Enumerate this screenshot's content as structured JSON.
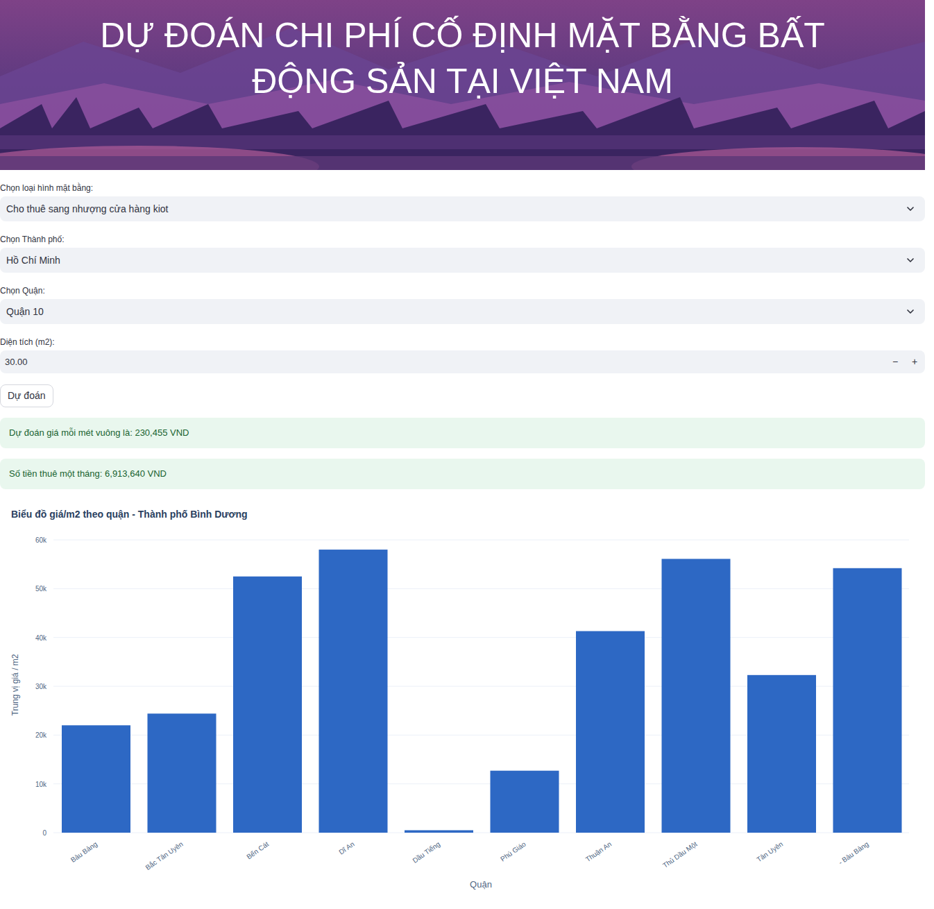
{
  "banner": {
    "title_lines": [
      "DỰ ĐOÁN CHI PHÍ CỐ ĐỊNH MẶT BẰNG BẤT",
      "ĐỘNG SẢN TẠI VIỆT NAM"
    ]
  },
  "form": {
    "fields": [
      {
        "label": "Chọn loại hình mặt bằng:",
        "value": "Cho thuê sang nhượng cửa hàng kiot",
        "kind": "select"
      },
      {
        "label": "Chọn Thành phố:",
        "value": "Hồ Chí Minh",
        "kind": "select"
      },
      {
        "label": "Chọn Quận:",
        "value": "Quận 10",
        "kind": "select"
      },
      {
        "label": "Diện tích (m2):",
        "value": "30.00",
        "kind": "number",
        "decrement": "−",
        "increment": "+"
      }
    ]
  },
  "button": "Dự đoán",
  "results": [
    "Dự đoán giá mỗi mét vuông là: 230,455 VND",
    "Số tiền thuê một tháng: 6,913,640 VND"
  ],
  "chart": {
    "title": "Biểu đồ giá/m2 theo quận - Thành phố Bình Dương",
    "y_axis_title": "Trung vị giá / m2",
    "x_axis_title": "Quận",
    "y_ticks": [
      "0",
      "10k",
      "20k",
      "30k",
      "40k",
      "50k",
      "60k"
    ],
    "y_tick_values": [
      0,
      10000,
      20000,
      30000,
      40000,
      50000,
      60000
    ],
    "categories": [
      "Bàu Bàng",
      "Bắc Tân Uyên",
      "Bến Cát",
      "Dĩ An",
      "Dầu Tiếng",
      "Phú Giáo",
      "Thuận An",
      "Thủ Dầu Một",
      "Tân Uyên",
      "- Bàu Bàng"
    ],
    "values": [
      22000,
      24400,
      52500,
      58000,
      500,
      12700,
      41300,
      56100,
      32300,
      54200
    ]
  }
}
